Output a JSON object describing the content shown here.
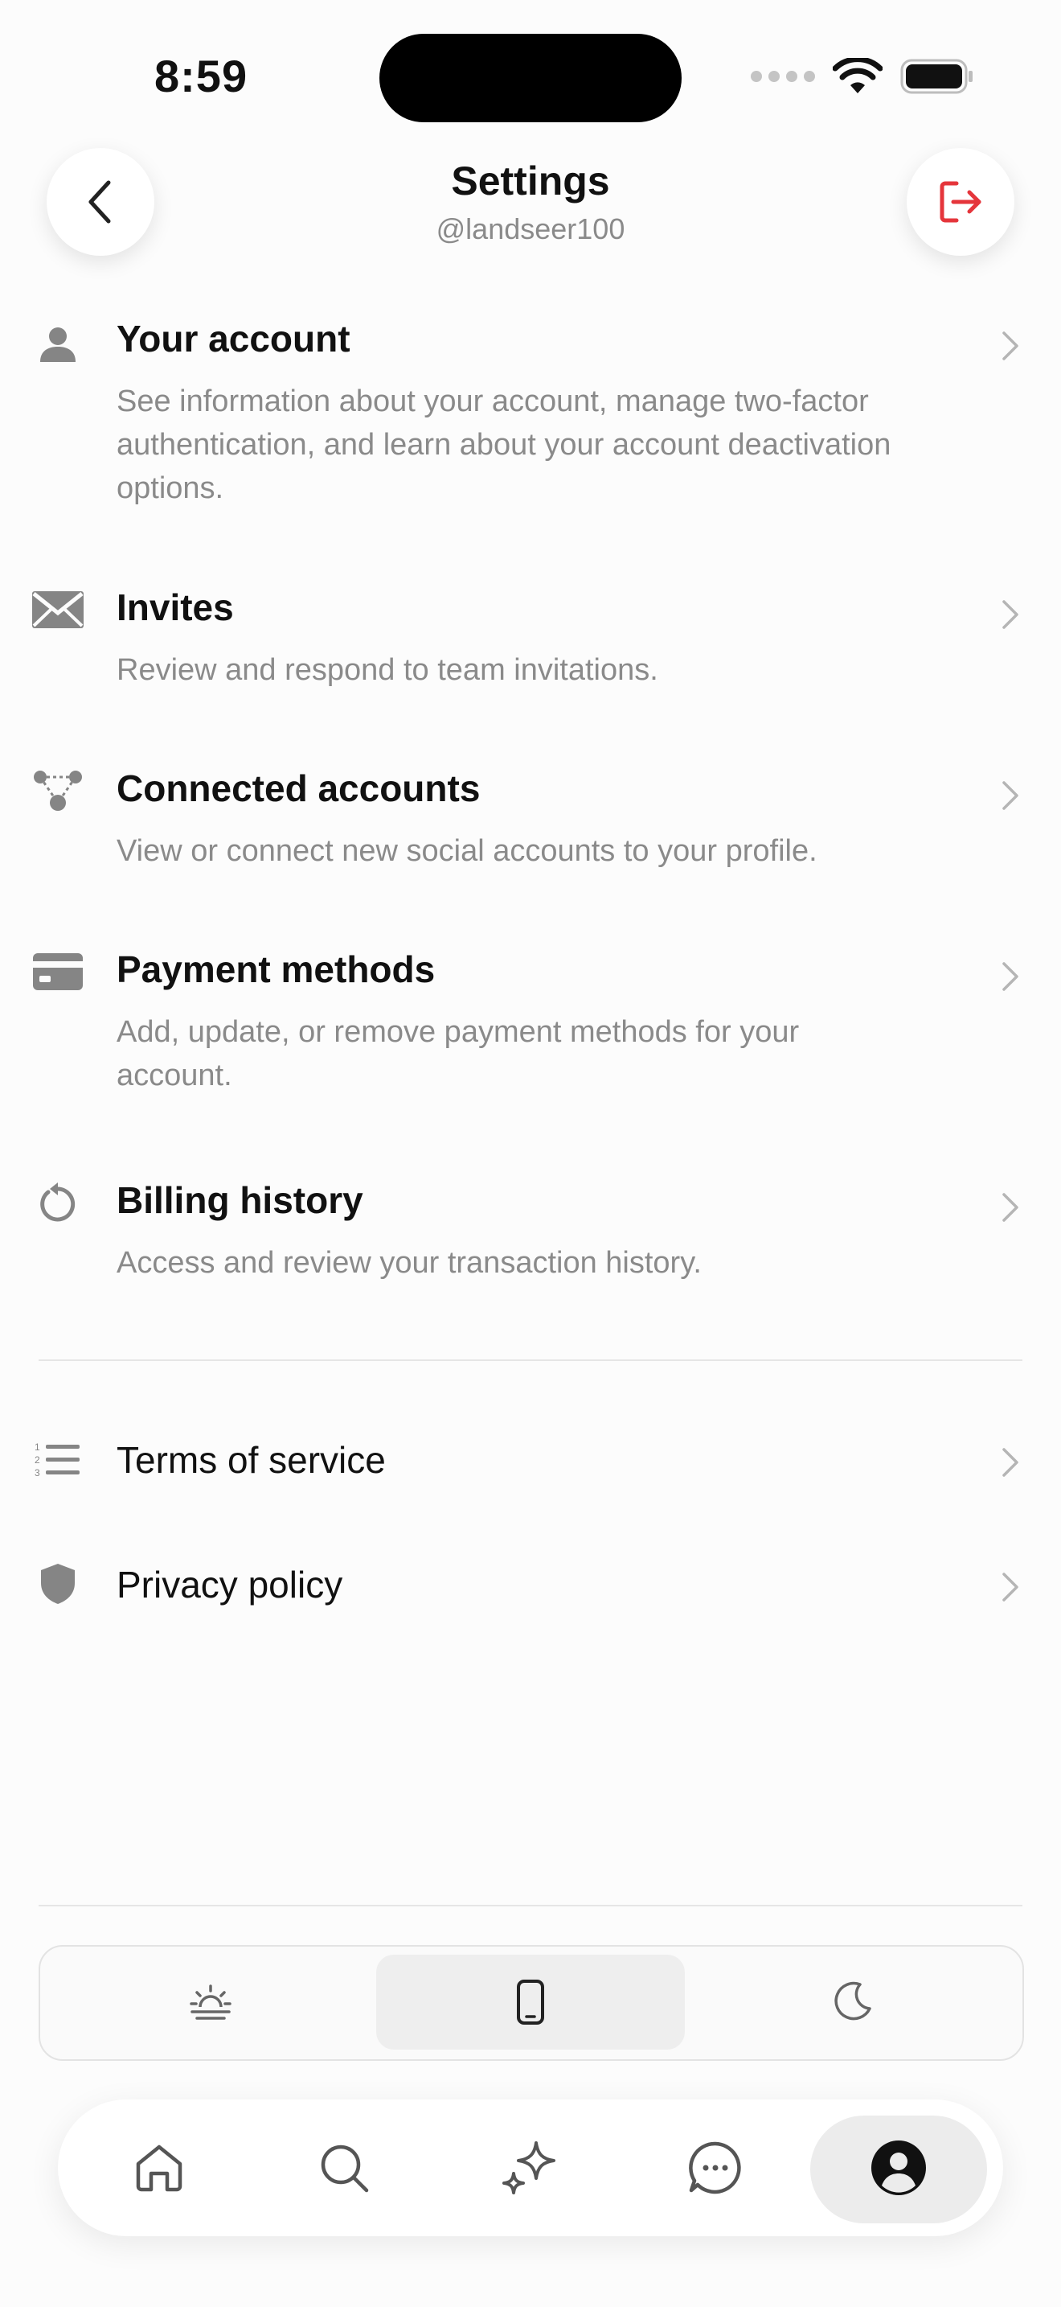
{
  "status_bar": {
    "time": "8:59"
  },
  "header": {
    "title": "Settings",
    "username": "@landseer100",
    "back_icon": "chevron-left-icon",
    "logout_icon": "logout-icon",
    "logout_color": "#e5353b"
  },
  "settings_items": [
    {
      "icon": "person-icon",
      "title": "Your account",
      "description": "See information about your account, manage two-factor authentication, and learn about your account deactivation options."
    },
    {
      "icon": "envelope-icon",
      "title": "Invites",
      "description": "Review and respond to team invitations."
    },
    {
      "icon": "connected-nodes-icon",
      "title": "Connected accounts",
      "description": "View or connect new social accounts to your profile."
    },
    {
      "icon": "credit-card-icon",
      "title": "Payment methods",
      "description": "Add, update, or remove payment methods for your account."
    },
    {
      "icon": "history-icon",
      "title": "Billing history",
      "description": "Access and review your transaction history."
    }
  ],
  "legal_items": [
    {
      "icon": "numbered-list-icon",
      "title": "Terms of service"
    },
    {
      "icon": "shield-icon",
      "title": "Privacy policy"
    }
  ],
  "theme_options": [
    {
      "icon": "sunrise-icon",
      "name": "light"
    },
    {
      "icon": "phone-icon",
      "name": "system",
      "selected": true
    },
    {
      "icon": "moon-icon",
      "name": "dark"
    }
  ],
  "bottom_nav": [
    {
      "icon": "home-icon"
    },
    {
      "icon": "search-icon"
    },
    {
      "icon": "sparkle-icon"
    },
    {
      "icon": "chat-icon"
    },
    {
      "icon": "profile-icon",
      "active": true
    }
  ]
}
